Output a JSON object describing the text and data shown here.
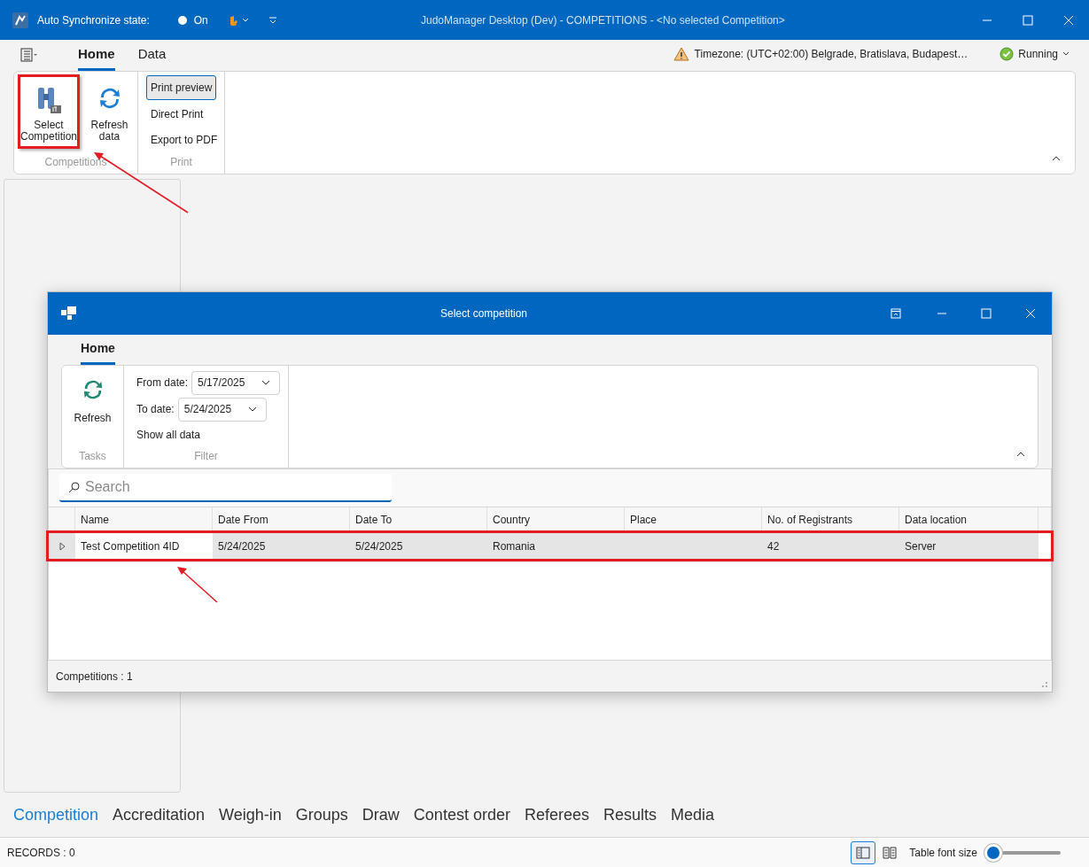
{
  "title_bar": {
    "sync_label": "Auto Synchronize state:",
    "sync_toggle": {
      "label": "On"
    },
    "title": "JudoManager Desktop (Dev) - COMPETITIONS - <No selected Competition>"
  },
  "ribbon": {
    "tabs": [
      {
        "label": "Home",
        "selected": true
      },
      {
        "label": "Data",
        "selected": false
      }
    ],
    "timezone": "Timezone: (UTC+02:00) Belgrade, Bratislava, Budapest…",
    "status": "Running",
    "competitions_group": {
      "label": "Competitions",
      "buttons": [
        {
          "label": "Select Competition",
          "kind": "binoculars",
          "highlighted": true
        },
        {
          "label": "Refresh data",
          "kind": "refresh",
          "highlighted": false
        }
      ]
    },
    "print_group": {
      "label": "Print",
      "items": [
        {
          "label": "Print preview",
          "selected": true
        },
        {
          "label": "Direct Print",
          "selected": false
        },
        {
          "label": "Export to PDF",
          "selected": false
        }
      ]
    }
  },
  "bottom_tabs": [
    {
      "label": "Competition",
      "selected": true
    },
    {
      "label": "Accreditation",
      "selected": false
    },
    {
      "label": "Weigh-in",
      "selected": false
    },
    {
      "label": "Groups",
      "selected": false
    },
    {
      "label": "Draw",
      "selected": false
    },
    {
      "label": "Contest order",
      "selected": false
    },
    {
      "label": "Referees",
      "selected": false
    },
    {
      "label": "Results",
      "selected": false
    },
    {
      "label": "Media",
      "selected": false
    }
  ],
  "status_bar": {
    "records": "RECORDS : 0",
    "font_size_label": "Table font size",
    "font_size_slider": {
      "level": 0
    }
  },
  "dialog": {
    "title": "Select competition",
    "tabs": [
      {
        "label": "Home",
        "selected": true
      }
    ],
    "tasks_group": {
      "label": "Tasks",
      "refresh": "Refresh"
    },
    "filter_group": {
      "label": "Filter",
      "from_label": "From date:",
      "from_value": "5/17/2025",
      "to_label": "To date:",
      "to_value": "5/24/2025",
      "show_all": "Show all data"
    },
    "search": {
      "placeholder": "Search"
    },
    "table": {
      "columns": [
        "Name",
        "Date From",
        "Date To",
        "Country",
        "Place",
        "No. of Registrants",
        "Data location"
      ],
      "rows": [
        {
          "cells": [
            "Test Competition 4ID",
            "5/24/2025",
            "5/24/2025",
            "Romania",
            "",
            "42",
            "Server"
          ],
          "selected": true,
          "highlighted": true
        }
      ]
    },
    "footer": "Competitions : 1"
  }
}
